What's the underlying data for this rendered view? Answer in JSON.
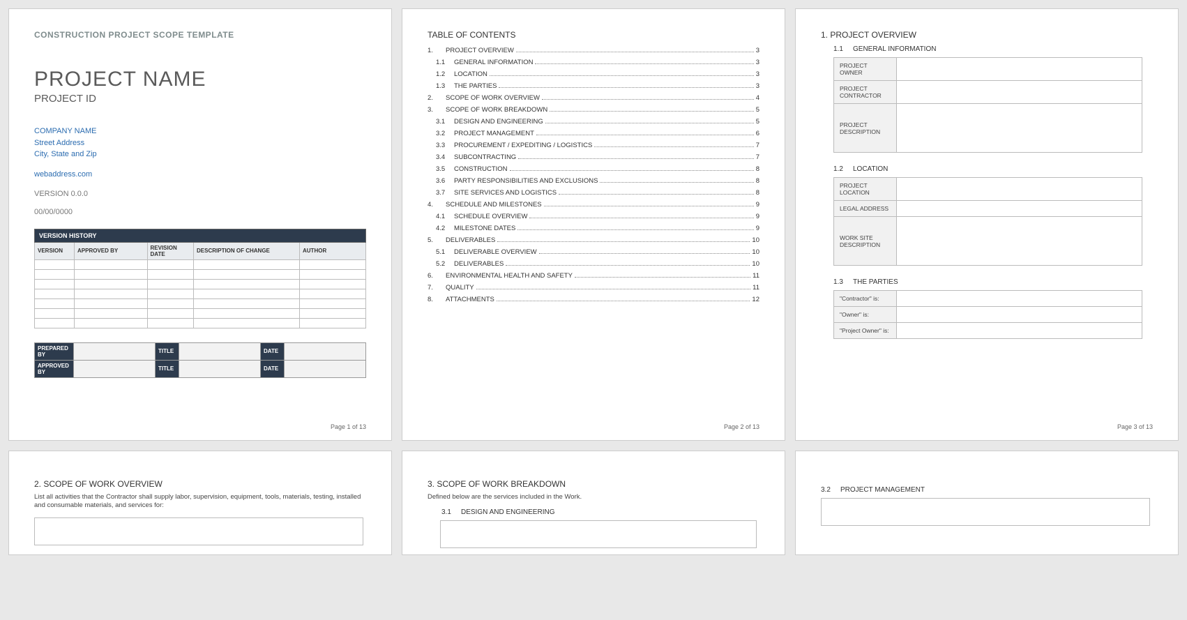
{
  "total_pages": 13,
  "page1": {
    "template_header": "CONSTRUCTION PROJECT SCOPE TEMPLATE",
    "project_name": "PROJECT NAME",
    "project_id": "PROJECT ID",
    "company": "COMPANY NAME",
    "street": "Street Address",
    "city_state_zip": "City, State and Zip",
    "webaddress": "webaddress.com",
    "version": "VERSION 0.0.0",
    "date": "00/00/0000",
    "vh_title": "VERSION HISTORY",
    "vh_cols": [
      "VERSION",
      "APPROVED BY",
      "REVISION DATE",
      "DESCRIPTION OF CHANGE",
      "AUTHOR"
    ],
    "sign": {
      "prepared": "PREPARED BY",
      "approved": "APPROVED BY",
      "title": "TITLE",
      "date": "DATE"
    },
    "footer": "Page 1 of 13"
  },
  "page2": {
    "heading": "TABLE OF CONTENTS",
    "items": [
      {
        "n": "1.",
        "t": "PROJECT OVERVIEW",
        "p": "3",
        "sub": false
      },
      {
        "n": "1.1",
        "t": "GENERAL INFORMATION",
        "p": "3",
        "sub": true
      },
      {
        "n": "1.2",
        "t": "LOCATION",
        "p": "3",
        "sub": true
      },
      {
        "n": "1.3",
        "t": "THE PARTIES",
        "p": "3",
        "sub": true
      },
      {
        "n": "2.",
        "t": "SCOPE OF WORK OVERVIEW",
        "p": "4",
        "sub": false
      },
      {
        "n": "3.",
        "t": "SCOPE OF WORK BREAKDOWN",
        "p": "5",
        "sub": false
      },
      {
        "n": "3.1",
        "t": "DESIGN AND ENGINEERING",
        "p": "5",
        "sub": true
      },
      {
        "n": "3.2",
        "t": "PROJECT MANAGEMENT",
        "p": "6",
        "sub": true
      },
      {
        "n": "3.3",
        "t": "PROCUREMENT / EXPEDITING / LOGISTICS",
        "p": "7",
        "sub": true
      },
      {
        "n": "3.4",
        "t": "SUBCONTRACTING",
        "p": "7",
        "sub": true
      },
      {
        "n": "3.5",
        "t": "CONSTRUCTION",
        "p": "8",
        "sub": true
      },
      {
        "n": "3.6",
        "t": "PARTY RESPONSIBILITIES AND EXCLUSIONS",
        "p": "8",
        "sub": true
      },
      {
        "n": "3.7",
        "t": "SITE SERVICES AND LOGISTICS",
        "p": "8",
        "sub": true
      },
      {
        "n": "4.",
        "t": "SCHEDULE AND MILESTONES",
        "p": "9",
        "sub": false
      },
      {
        "n": "4.1",
        "t": "SCHEDULE OVERVIEW",
        "p": "9",
        "sub": true
      },
      {
        "n": "4.2",
        "t": "MILESTONE DATES",
        "p": "9",
        "sub": true
      },
      {
        "n": "5.",
        "t": "DELIVERABLES",
        "p": "10",
        "sub": false
      },
      {
        "n": "5.1",
        "t": "DELIVERABLE OVERVIEW",
        "p": "10",
        "sub": true
      },
      {
        "n": "5.2",
        "t": "DELIVERABLES",
        "p": "10",
        "sub": true
      },
      {
        "n": "6.",
        "t": "ENVIRONMENTAL HEALTH AND SAFETY",
        "p": "11",
        "sub": false
      },
      {
        "n": "7.",
        "t": "QUALITY",
        "p": "11",
        "sub": false
      },
      {
        "n": "8.",
        "t": "ATTACHMENTS",
        "p": "12",
        "sub": false
      }
    ],
    "footer": "Page 2 of 13"
  },
  "page3": {
    "h1": "1.  PROJECT OVERVIEW",
    "s11_n": "1.1",
    "s11_t": "GENERAL INFORMATION",
    "s12_n": "1.2",
    "s12_t": "LOCATION",
    "s13_n": "1.3",
    "s13_t": "THE PARTIES",
    "gen": {
      "owner": "PROJECT OWNER",
      "contractor": "PROJECT CONTRACTOR",
      "descr": "PROJECT DESCRIPTION"
    },
    "loc": {
      "location": "PROJECT LOCATION",
      "legal": "LEGAL ADDRESS",
      "wsd": "WORK SITE DESCRIPTION"
    },
    "parties": {
      "contractor": "\"Contractor\" is:",
      "owner": "\"Owner\" is:",
      "powner": "\"Project Owner\" is:"
    },
    "footer": "Page 3 of 13"
  },
  "page4": {
    "h": "2.  SCOPE OF WORK OVERVIEW",
    "desc": "List all activities that the Contractor shall supply labor, supervision, equipment, tools, materials, testing, installed and consumable materials, and services for:"
  },
  "page5": {
    "h": "3.  SCOPE OF WORK BREAKDOWN",
    "desc": "Defined below are the services included in the Work.",
    "s31_n": "3.1",
    "s31_t": "DESIGN AND ENGINEERING"
  },
  "page6": {
    "s32_n": "3.2",
    "s32_t": "PROJECT MANAGEMENT"
  }
}
